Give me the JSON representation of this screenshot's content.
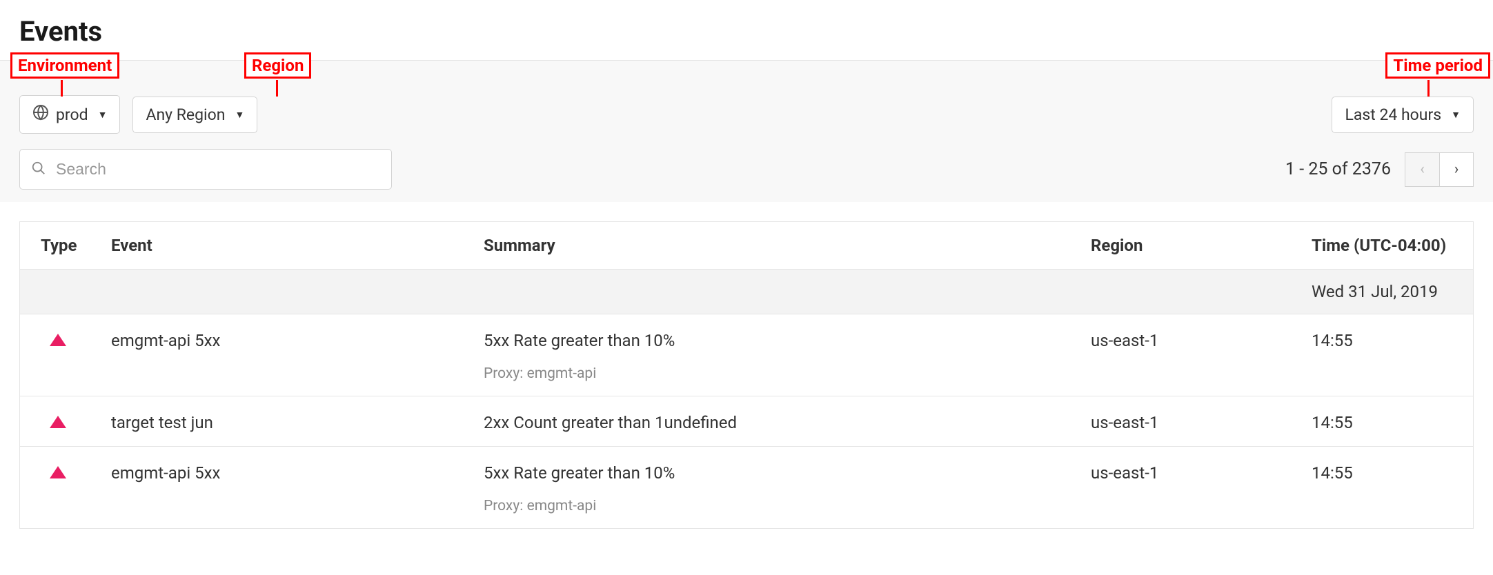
{
  "header": {
    "title": "Events"
  },
  "annotations": {
    "env": "Environment",
    "region": "Region",
    "time": "Time period"
  },
  "filters": {
    "env_label": "prod",
    "region_label": "Any Region",
    "time_label": "Last 24 hours",
    "search_placeholder": "Search"
  },
  "pagination": {
    "range_text": "1 - 25 of 2376"
  },
  "table": {
    "columns": {
      "type": "Type",
      "event": "Event",
      "summary": "Summary",
      "region": "Region",
      "time": "Time (UTC-04:00)"
    },
    "date_header": "Wed 31 Jul, 2019",
    "rows": [
      {
        "event": "emgmt-api 5xx",
        "summary": "5xx Rate greater than 10%",
        "sub": "Proxy: emgmt-api",
        "region": "us-east-1",
        "time": "14:55"
      },
      {
        "event": "target test jun",
        "summary": "2xx Count greater than 1undefined",
        "sub": "",
        "region": "us-east-1",
        "time": "14:55"
      },
      {
        "event": "emgmt-api 5xx",
        "summary": "5xx Rate greater than 10%",
        "sub": "Proxy: emgmt-api",
        "region": "us-east-1",
        "time": "14:55"
      }
    ]
  }
}
